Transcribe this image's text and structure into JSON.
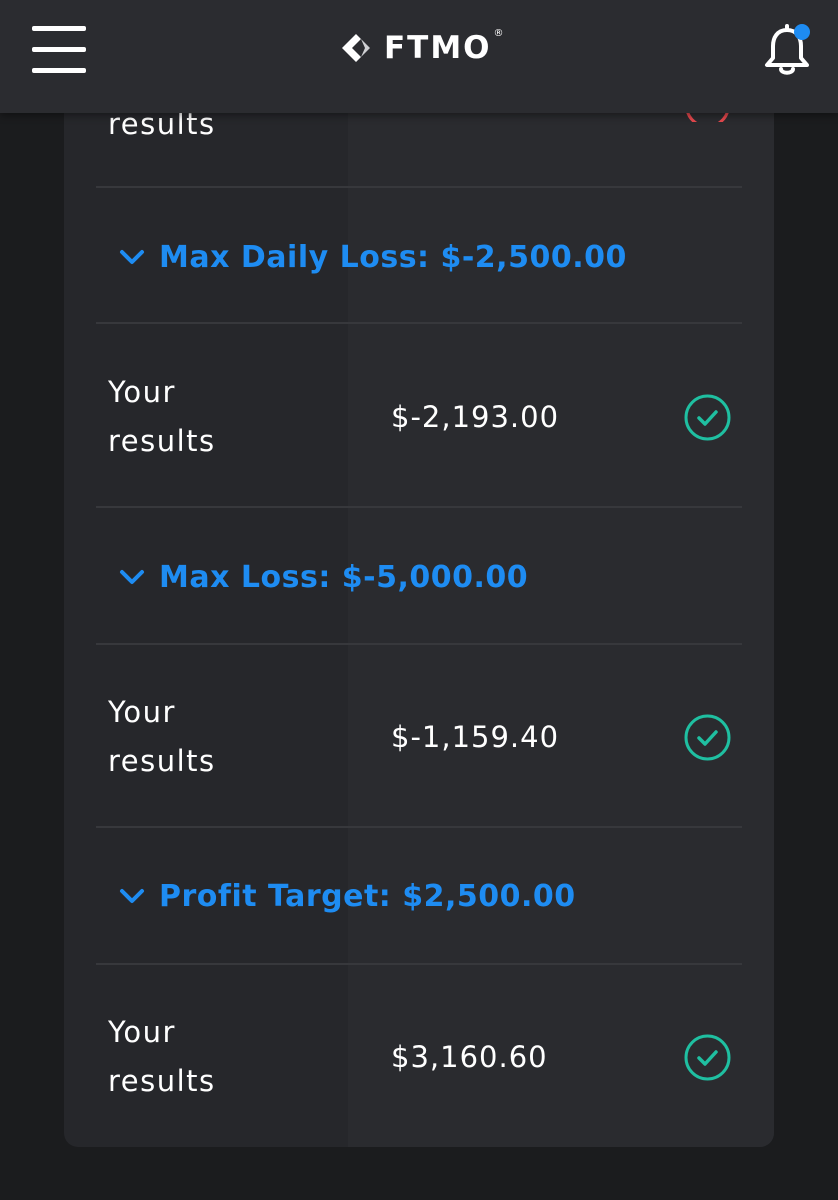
{
  "header": {
    "brand": "FTMO",
    "brand_mark": "®",
    "menu_icon": "hamburger-menu-icon",
    "notification_icon": "bell-icon",
    "notification_badge_color": "#1e8cf2"
  },
  "partial_row": {
    "label_line2": "results"
  },
  "sections": [
    {
      "title": "Max Daily Loss: $-2,500.00",
      "result_label_line1": "Your",
      "result_label_line2": "results",
      "result_value": "$-2,193.00",
      "status": "passed"
    },
    {
      "title": "Max Loss: $-5,000.00",
      "result_label_line1": "Your",
      "result_label_line2": "results",
      "result_value": "$-1,159.40",
      "status": "passed"
    },
    {
      "title": "Profit Target: $2,500.00",
      "result_label_line1": "Your",
      "result_label_line2": "results",
      "result_value": "$3,160.60",
      "status": "passed"
    }
  ],
  "colors": {
    "accent": "#1e8cf2",
    "success": "#1fbfa1",
    "fail": "#e5484d",
    "background": "#1b1c1e",
    "card": "#26272b"
  }
}
